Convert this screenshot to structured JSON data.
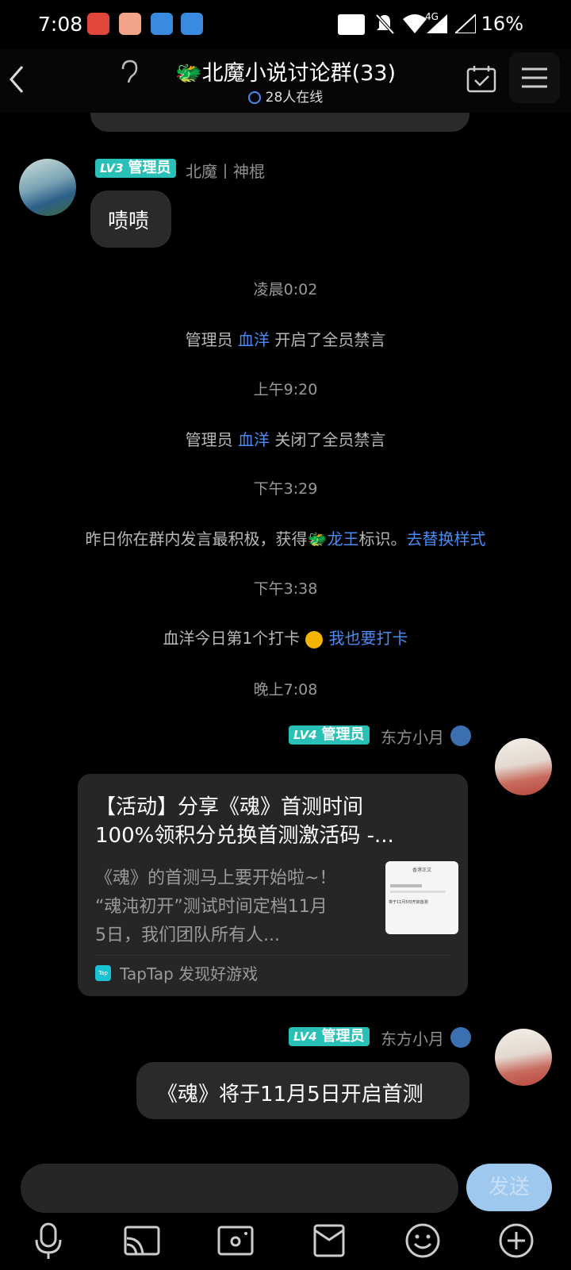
{
  "status_bar": {
    "time": "7:08",
    "network": "4G",
    "battery": "16%"
  },
  "header": {
    "title": "🐲北魔小说讨论群(33)",
    "online": "28人在线"
  },
  "messages": {
    "m1": {
      "badge_level": "LV3",
      "badge_role": "管理员",
      "sender": "北魔丨神棍",
      "text": "啧啧"
    },
    "t1": "凌晨0:02",
    "s1": {
      "prefix": "管理员 ",
      "name": "血洋",
      "suffix": " 开启了全员禁言"
    },
    "t2": "上午9:20",
    "s2": {
      "prefix": "管理员 ",
      "name": "血洋",
      "suffix": " 关闭了全员禁言"
    },
    "t3": "下午3:29",
    "s3": {
      "prefix": "昨日你在群内发言最积极，获得🐲",
      "name": "龙王",
      "mid": "标识。",
      "link": "去替换样式"
    },
    "t4": "下午3:38",
    "s4": {
      "text": "血洋今日第1个打卡 ",
      "link": "我也要打卡"
    },
    "t5": "晚上7:08",
    "m2": {
      "badge_level": "LV4",
      "badge_role": "管理员",
      "sender": "东方小月",
      "card_title_line1": "【活动】分享《魂》首测时间",
      "card_title_line2": "100%领积分兑换首测激活码 -...",
      "card_desc_line1": "《魂》的首测马上要开始啦~！",
      "card_desc_line2": "“魂沌初开”测试时间定档11月",
      "card_desc_line3": "5日，我们团队所有人...",
      "card_thumb_title": "香港正文",
      "card_thumb_text": "将于11月5日开启首测",
      "card_source_icon": "Tap",
      "card_source": "TapTap 发现好游戏"
    },
    "m3": {
      "badge_level": "LV4",
      "badge_role": "管理员",
      "sender": "东方小月",
      "text": "《魂》将于11月5日开启首测"
    }
  },
  "composer": {
    "send_label": "发送",
    "placeholder": ""
  },
  "toolbar": [
    "mic-icon",
    "cast-icon",
    "photo-icon",
    "gift-icon",
    "emoji-icon",
    "plus-icon"
  ],
  "colors": {
    "accent_link": "#4a8cf3",
    "badge": "#29c0b7",
    "bubble": "#2a2a2a",
    "send_button": "#9fc8ef"
  }
}
